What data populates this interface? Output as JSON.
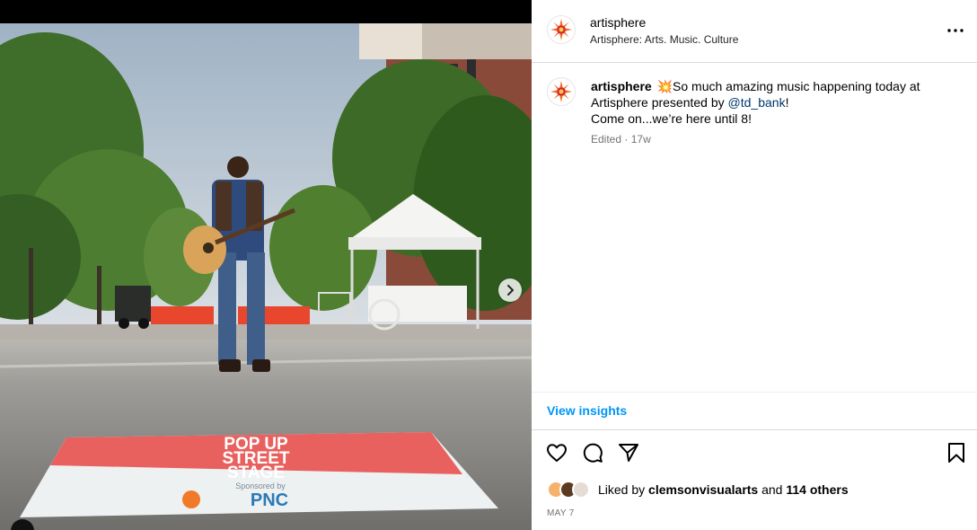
{
  "post": {
    "username": "artisphere",
    "account_subtitle": "Artisphere: Arts. Music. Culture",
    "caption": {
      "username": "artisphere",
      "emoji": "💥",
      "text_part1": "So much amazing music happening today at Artisphere presented by ",
      "mention": "@td_bank",
      "text_part2": "!",
      "line2": "Come on...we’re here until 8!"
    },
    "edited_label": "Edited",
    "meta_separator": "·",
    "age": "17w",
    "view_insights_label": "View insights",
    "liked_by_prefix": "Liked by",
    "liked_by_user": "clemsonvisualarts",
    "and_label": "and",
    "others_label": "114 others",
    "date": "MAY 7"
  },
  "media": {
    "sign_line1": "POP UP",
    "sign_line2": "STREET",
    "sign_line3": "STAGE",
    "sponsor_label": "Sponsored by",
    "sponsor_name": "PNC"
  },
  "icons": {
    "more": "more-options-icon",
    "like": "heart-icon",
    "comment": "comment-icon",
    "share": "share-icon",
    "save": "bookmark-icon",
    "next": "chevron-right-icon"
  },
  "colors": {
    "link_blue": "#0095f6",
    "mention_blue": "#00376b",
    "meta_gray": "#737373",
    "brand_orange": "#f26b21",
    "brand_red": "#d62828",
    "sign_red": "#e9615e"
  }
}
